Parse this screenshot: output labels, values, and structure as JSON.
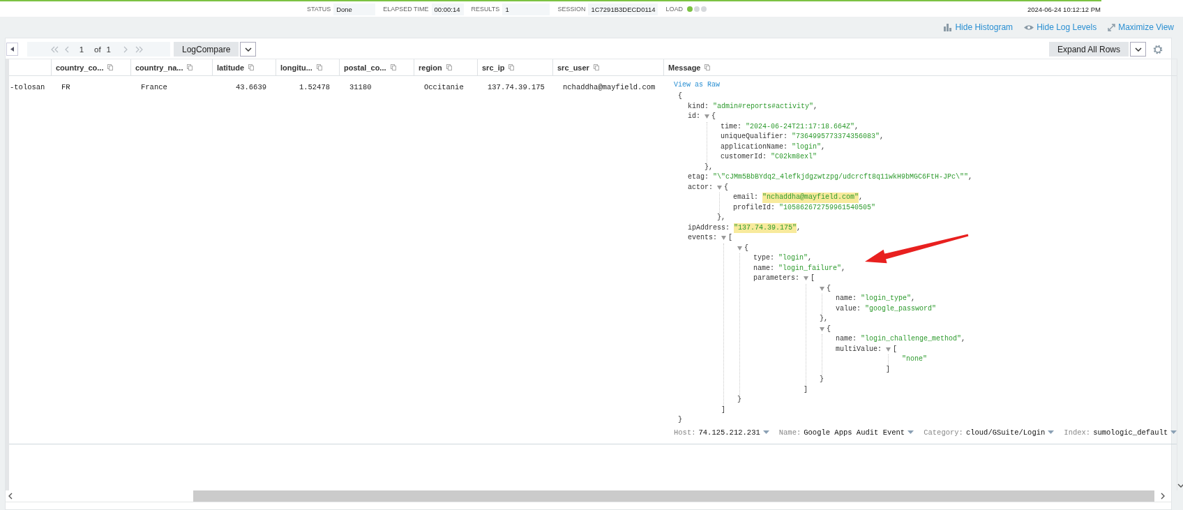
{
  "status_bar": {
    "items": [
      {
        "label": "STATUS",
        "value": "Done"
      },
      {
        "label": "ELAPSED TIME",
        "value": "00:00:14"
      },
      {
        "label": "RESULTS",
        "value": "1"
      },
      {
        "label": "SESSION",
        "value": "1C7291B3DECD0114"
      }
    ],
    "load_label": "LOAD",
    "load_dots": [
      {
        "on": true
      },
      {
        "on": false
      },
      {
        "on": false
      }
    ],
    "timestamp": "2024-06-24 10:12:12 PM"
  },
  "view_links": [
    {
      "label": "Hide Histogram",
      "kind": "histogram"
    },
    {
      "label": "Hide Log Levels",
      "kind": "eye"
    },
    {
      "label": "Maximize View",
      "kind": "maximize"
    }
  ],
  "pager": {
    "nav": [
      {
        "kind": "first",
        "disabled": true
      },
      {
        "kind": "prev",
        "disabled": true
      },
      {
        "kind": "next",
        "disabled": true
      },
      {
        "kind": "last",
        "disabled": true
      }
    ],
    "page": "1",
    "of_label": "of",
    "total": "1"
  },
  "compare_button": "LogCompare",
  "expand_button": "Expand All Rows",
  "table": {
    "columns": [
      "",
      "country_co...",
      "country_na...",
      "latitude",
      "longitu...",
      "postal_co...",
      "region",
      "src_ip",
      "src_user",
      "Message"
    ],
    "rows": [
      {
        "cells": [
          "-tolosan",
          "FR",
          "France",
          "43.6639",
          "1.52478",
          "31180",
          "Occitanie",
          "137.74.39.175",
          "nchaddha@mayfield.com"
        ],
        "message": {
          "view_raw": "View as Raw",
          "root": {
            "open": "{",
            "close": "}",
            "children": [
              {
                "key": "kind:",
                "value": "\"admin#reports#activity\"",
                "after": ",",
                "highlighted": false
              },
              {
                "key": "id:",
                "open": "{",
                "expanded": true,
                "close": "},",
                "children": [
                  {
                    "key": "time:",
                    "value": "\"2024-06-24T21:17:18.664Z\"",
                    "after": ",",
                    "highlighted": false
                  },
                  {
                    "key": "uniqueQualifier:",
                    "value": "\"7364995773374356083\"",
                    "after": ",",
                    "highlighted": false
                  },
                  {
                    "key": "applicationName:",
                    "value": "\"login\"",
                    "after": ",",
                    "highlighted": false
                  },
                  {
                    "key": "customerId:",
                    "value": "\"C02km8exl\"",
                    "highlighted": false
                  }
                ]
              },
              {
                "key": "etag:",
                "value": "\"\\\"cJMm5BbBYdq2_4lefkjdgzwtzpg/udcrcft8q11wkH9bMGC6FtH-JPc\\\"\"",
                "after": ",",
                "highlighted": false
              },
              {
                "key": "actor:",
                "open": "{",
                "expanded": true,
                "close": "},",
                "children": [
                  {
                    "key": "email:",
                    "value": "\"nchaddha@mayfield.com\"",
                    "after": ",",
                    "highlighted": true
                  },
                  {
                    "key": "profileId:",
                    "value": "\"105862672759961540505\"",
                    "highlighted": false
                  }
                ]
              },
              {
                "key": "ipAddress:",
                "value": "\"137.74.39.175\"",
                "after": ",",
                "highlighted": true
              },
              {
                "key": "events:",
                "open": "[",
                "expanded": true,
                "close": "]",
                "children": [
                  {
                    "open": "{",
                    "expanded": true,
                    "close": "}",
                    "children": [
                      {
                        "key": "type:",
                        "value": "\"login\"",
                        "after": ",",
                        "highlighted": false
                      },
                      {
                        "key": "name:",
                        "value": "\"login_failure\"",
                        "after": ",",
                        "highlighted": false
                      },
                      {
                        "key": "parameters:",
                        "open": "[",
                        "expanded": true,
                        "close": "]",
                        "children": [
                          {
                            "open": "{",
                            "expanded": true,
                            "close": "},",
                            "children": [
                              {
                                "key": "name:",
                                "value": "\"login_type\"",
                                "after": ",",
                                "highlighted": false
                              },
                              {
                                "key": "value:",
                                "value": "\"google_password\"",
                                "highlighted": false
                              }
                            ]
                          },
                          {
                            "open": "{",
                            "expanded": true,
                            "close": "}",
                            "children": [
                              {
                                "key": "name:",
                                "value": "\"login_challenge_method\"",
                                "after": ",",
                                "highlighted": false
                              },
                              {
                                "key": "multiValue:",
                                "open": "[",
                                "expanded": true,
                                "close": "]",
                                "children": [
                                  {
                                    "value": "\"none\"",
                                    "highlighted": false
                                  }
                                ]
                              }
                            ]
                          }
                        ]
                      }
                    ]
                  }
                ]
              }
            ]
          },
          "fields": [
            {
              "label": "Host:",
              "value": "74.125.212.231"
            },
            {
              "label": "Name:",
              "value": "Google Apps Audit Event"
            },
            {
              "label": "Category:",
              "value": "cloud/GSuite/Login"
            },
            {
              "label": "Index:",
              "value": "sumologic_default"
            }
          ]
        }
      }
    ]
  }
}
